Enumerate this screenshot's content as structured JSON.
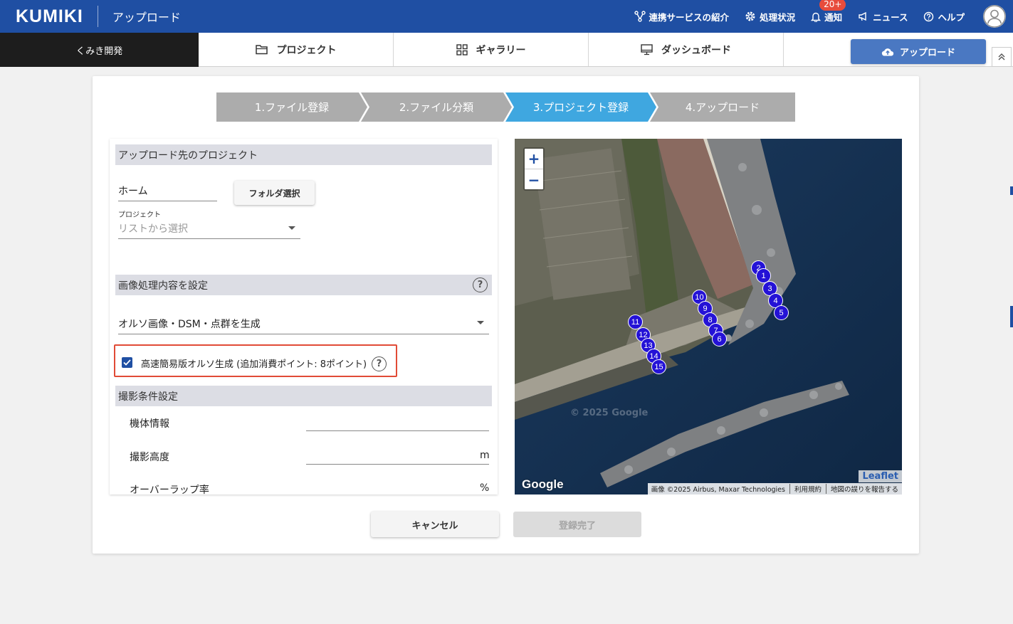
{
  "header": {
    "logo": "KUMIKI",
    "page_title": "アップロード",
    "links": [
      {
        "label": "連携サービスの紹介",
        "icon": "integration-icon"
      },
      {
        "label": "処理状況",
        "icon": "gear-icon"
      },
      {
        "label": "通知",
        "icon": "bell-icon",
        "badge": "20+"
      },
      {
        "label": "ニュース",
        "icon": "megaphone-icon"
      },
      {
        "label": "ヘルプ",
        "icon": "help-circle-icon"
      }
    ],
    "avatar_icon": "user-avatar-icon"
  },
  "nav": {
    "organization": "くみき開発",
    "tabs": [
      {
        "label": "プロジェクト",
        "icon": "folder-icon"
      },
      {
        "label": "ギャラリー",
        "icon": "grid-icon"
      },
      {
        "label": "ダッシュボード",
        "icon": "monitor-icon"
      }
    ],
    "upload_button": "アップロード"
  },
  "stepper": {
    "steps": [
      {
        "label": "1.ファイル登録",
        "active": false
      },
      {
        "label": "2.ファイル分類",
        "active": false
      },
      {
        "label": "3.プロジェクト登録",
        "active": true
      },
      {
        "label": "4.アップロード",
        "active": false
      }
    ],
    "active_color": "#3fa7e0",
    "inactive_color": "#acacac"
  },
  "form": {
    "project_section": {
      "title": "アップロード先のプロジェクト",
      "folder_value": "ホーム",
      "folder_button": "フォルダ選択",
      "project_label": "プロジェクト",
      "project_placeholder": "リストから選択"
    },
    "processing_section": {
      "title": "画像処理内容を設定",
      "selected_option": "オルソ画像・DSM・点群を生成",
      "fast_ortho_label": "高速簡易版オルソ生成 (追加消費ポイント: 8ポイント)",
      "fast_ortho_checked": true
    },
    "shooting_section": {
      "title": "撮影条件設定",
      "fields": [
        {
          "label": "機体情報",
          "value": "",
          "unit": ""
        },
        {
          "label": "撮影高度",
          "value": "",
          "unit": "m"
        },
        {
          "label": "オーバーラップ率",
          "value": "",
          "unit": "%"
        }
      ]
    }
  },
  "map": {
    "zoom_in": "+",
    "zoom_out": "−",
    "leaflet": "Leaflet",
    "google": "Google",
    "watermark": "© 2025 Google",
    "attribution": [
      "画像 ©2025 Airbus, Maxar Technologies",
      "利用規約",
      "地図の誤りを報告する"
    ],
    "markers": [
      "1",
      "2",
      "3",
      "4",
      "5",
      "6",
      "7",
      "8",
      "9",
      "10",
      "11",
      "12",
      "13",
      "14",
      "15"
    ]
  },
  "actions": {
    "cancel": "キャンセル",
    "complete": "登録完了"
  }
}
